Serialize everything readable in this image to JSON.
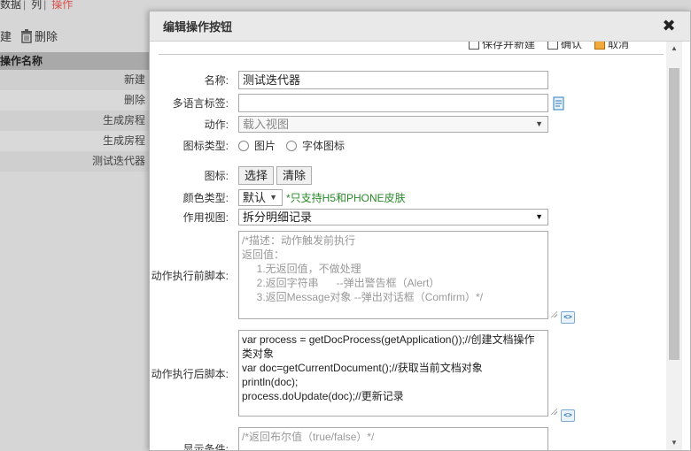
{
  "background": {
    "tabs": [
      "数据",
      "列",
      "操作"
    ],
    "toolbar": {
      "new_label": "建",
      "delete_label": "删除"
    },
    "table_header": "操作名称",
    "rows": [
      "新建",
      "删除",
      "生成房程",
      "生成房程",
      "测试迭代器"
    ]
  },
  "modal": {
    "title": "编辑操作按钮",
    "close_symbol": "✖",
    "top_actions": {
      "save_new": "保存并新建",
      "confirm": "确认",
      "cancel": "取消"
    },
    "fields": {
      "name": {
        "label": "名称:",
        "value": "测试迭代器"
      },
      "lang_tag": {
        "label": "多语言标签:",
        "value": ""
      },
      "action": {
        "label": "动作:",
        "value": "载入视图"
      },
      "icon_type": {
        "label": "图标类型:",
        "options": [
          "图片",
          "字体图标"
        ]
      },
      "icon": {
        "label": "图标:",
        "select_button": "选择",
        "clear_button": "清除"
      },
      "color_type": {
        "label": "颜色类型:",
        "value": "默认",
        "hint": "*只支持H5和PHONE皮肤"
      },
      "view": {
        "label": "作用视图:",
        "value": "拆分明细记录"
      },
      "before_script": {
        "label": "动作执行前脚本:",
        "placeholder": "/*描述：动作触发前执行\n返回值：\n     1.无返回值，不做处理\n     2.返回字符串      --弹出警告框（Alert）\n     3.返回Message对象 --弹出对话框（Comfirm）*/"
      },
      "after_script": {
        "label": "动作执行后脚本:",
        "value": "var process = getDocProcess(getApplication());//创建文档操作类对象\nvar doc=getCurrentDocument();//获取当前文档对象\nprintln(doc);\nprocess.doUpdate(doc);//更新记录"
      },
      "show_condition": {
        "label": "显示条件:",
        "placeholder": "/*返回布尔值（true/false）*/"
      }
    },
    "script_icon_text": "<>",
    "colors": {
      "hint_green": "#2a8a2a",
      "active_tab": "#d9534f"
    }
  }
}
